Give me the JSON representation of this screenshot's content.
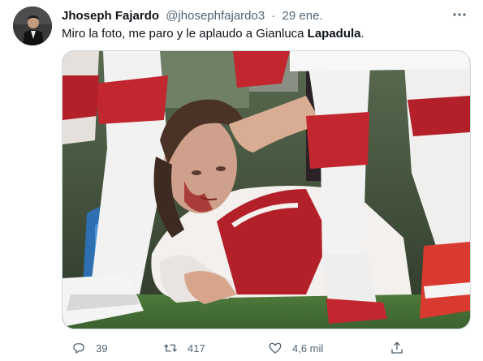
{
  "tweet": {
    "author_name": "Jhoseph Fajardo",
    "author_handle": "@jhosephfajardo3",
    "separator": "·",
    "time": "29 ene.",
    "text_before": "Miro la foto, me paro y le aplaudo a Gianluca ",
    "text_bold": "Lapadula",
    "text_after": ".",
    "media_alt": "photo of football player lying injured on the pitch",
    "icons": {
      "avatar": "user-avatar",
      "more": "more-icon",
      "reply": "reply-icon",
      "retweet": "retweet-icon",
      "like": "like-icon",
      "share": "share-icon"
    },
    "counts": {
      "reply": "39",
      "retweet": "417",
      "like": "4,6 mil"
    }
  },
  "colors": {
    "text_primary": "#0f1419",
    "text_secondary": "#536471",
    "border": "#cfd9de",
    "jersey_red": "#b3202a"
  }
}
